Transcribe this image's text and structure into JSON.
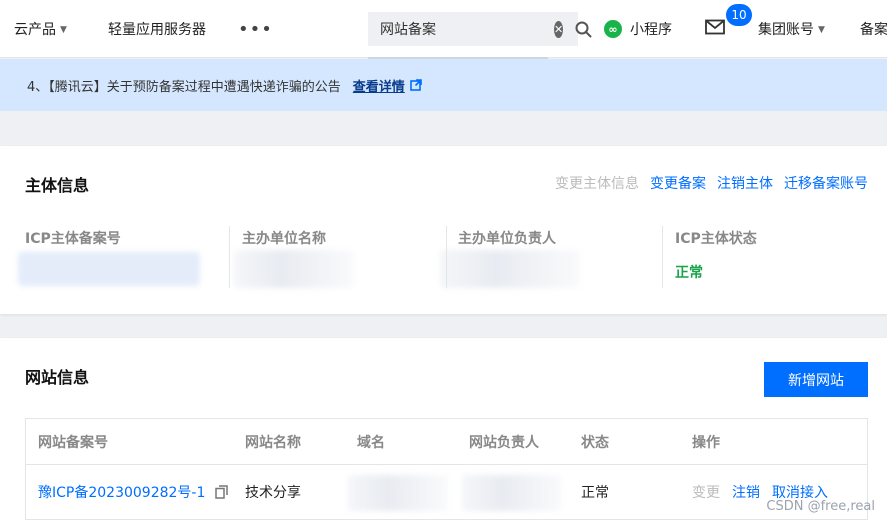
{
  "nav": {
    "products": "云产品",
    "lighthouse": "轻量应用服务器",
    "more": "•••",
    "search_value": "网站备案",
    "mini_program": "小程序",
    "mail_count": "10",
    "group_account": "集团账号",
    "beian": "备案"
  },
  "notice": {
    "text": "4、【腾讯云】关于预防备案过程中遭遇快递诈骗的公告",
    "link": "查看详情"
  },
  "entity": {
    "title": "主体信息",
    "actions": {
      "change_entity_info": "变更主体信息",
      "change_beian": "变更备案",
      "cancel_entity": "注销主体",
      "migrate_account": "迁移备案账号"
    },
    "columns": [
      {
        "label": "ICP主体备案号"
      },
      {
        "label": "主办单位名称"
      },
      {
        "label": "主办单位负责人"
      },
      {
        "label": "ICP主体状态",
        "value": "正常"
      }
    ]
  },
  "website": {
    "title": "网站信息",
    "add_button": "新增网站",
    "headers": [
      "网站备案号",
      "网站名称",
      "域名",
      "网站负责人",
      "状态",
      "操作"
    ],
    "rows": [
      {
        "icp": "豫ICP备2023009282号-1",
        "name": "技术分享",
        "status": "正常",
        "op_change": "变更",
        "op_cancel": "注销",
        "op_unlink": "取消接入"
      }
    ]
  },
  "watermark": "CSDN @free,real",
  "colors": {
    "primary": "#006eff",
    "success": "#19a34a",
    "notice_bg": "#d5e7ff"
  }
}
